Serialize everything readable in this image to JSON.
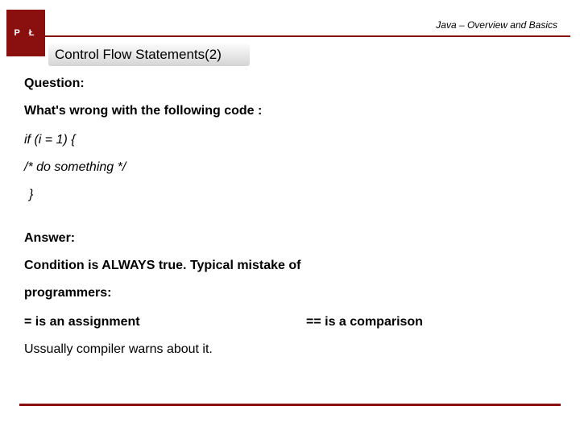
{
  "header": {
    "logo_text": "P  Ł",
    "top_label": "Java – Overview and Basics",
    "slide_title": "Control Flow Statements(2)"
  },
  "body": {
    "question_label": "Question:",
    "question_text": "What's wrong with the following code :",
    "code1": "if (i = 1) {",
    "code2": "/* do something */",
    "code3": "}",
    "answer_label": "Answer:",
    "answer_line1": "Condition is ALWAYS true. Typical mistake of",
    "answer_line2": "programmers:",
    "assign_text": "= is an assignment",
    "compare_text": "== is a comparison",
    "compiler_text": "Ussually compiler warns about it."
  }
}
